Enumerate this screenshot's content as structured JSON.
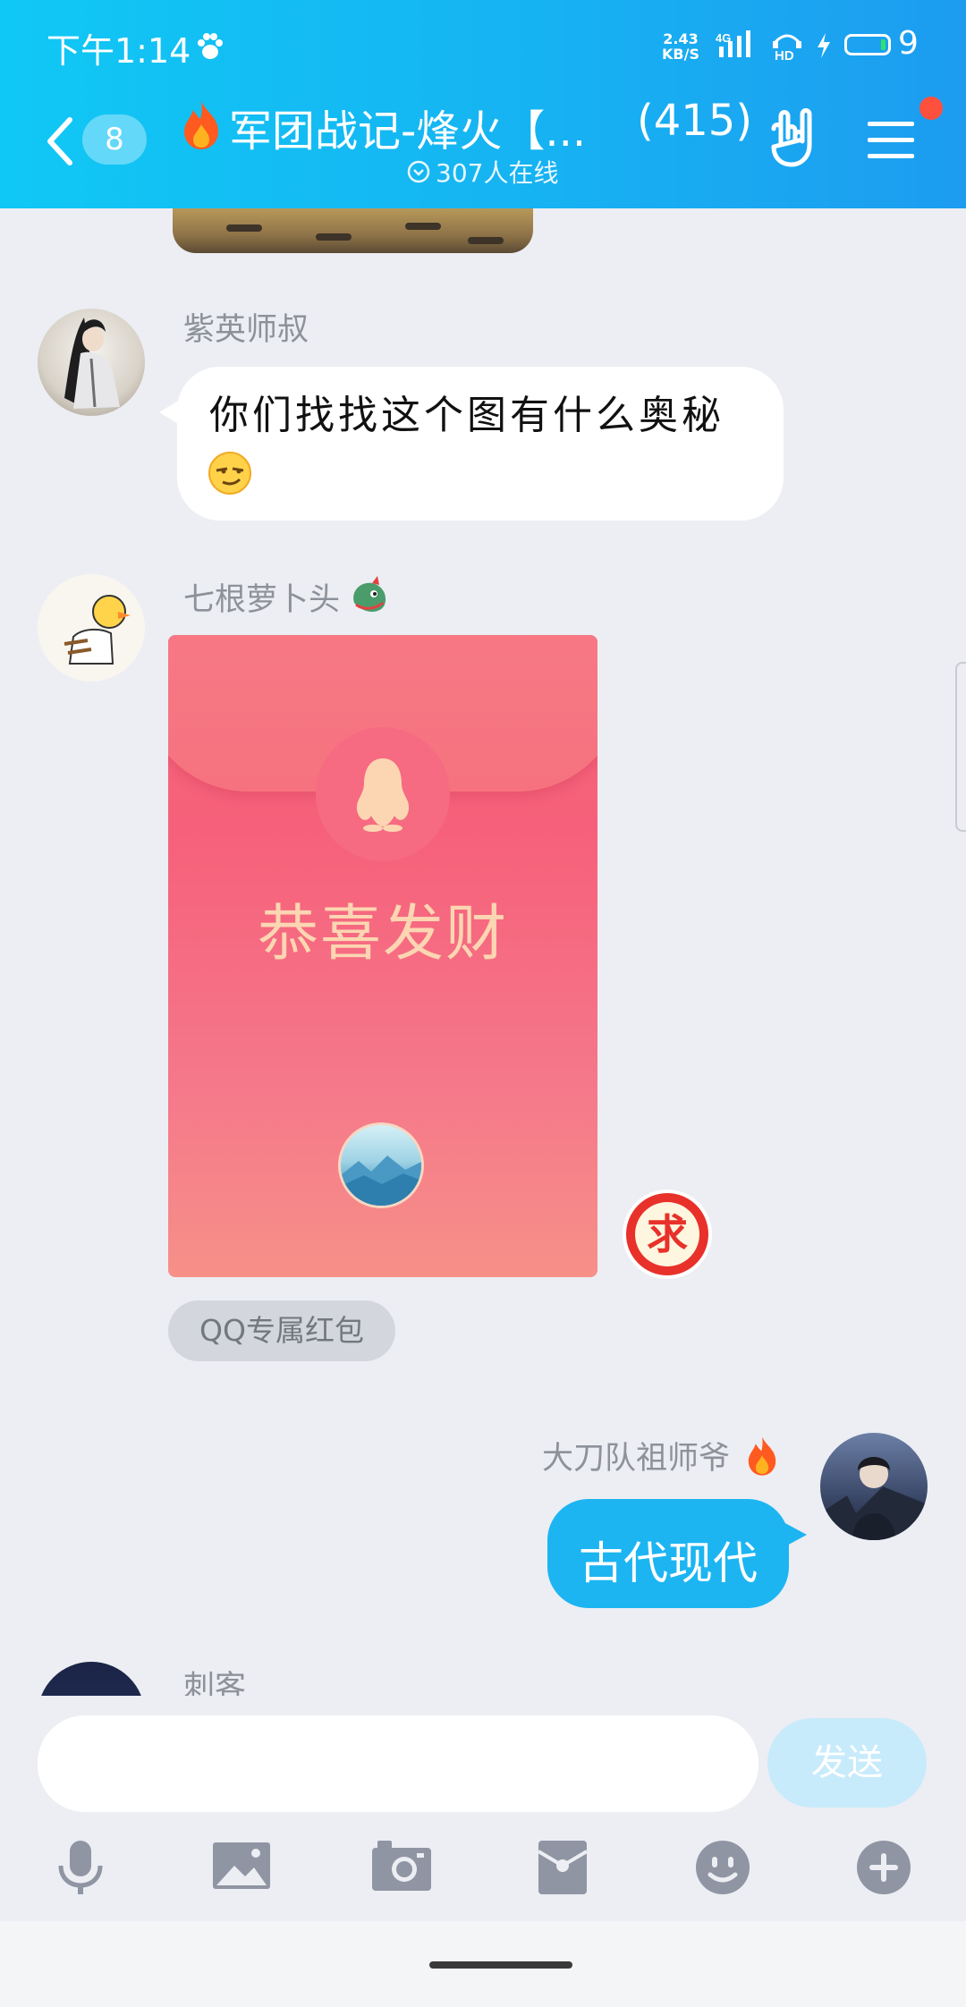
{
  "status_bar": {
    "time": "下午1:14",
    "net_speed_value": "2.43",
    "net_speed_unit": "KB/S",
    "network": "4G",
    "hd": "HD",
    "battery_level": "9"
  },
  "header": {
    "unread_count": "8",
    "group_title": "军团战记-烽火【...",
    "member_count": "(415)",
    "online_text": "307人在线"
  },
  "messages": [
    {
      "sender": "紫英师叔",
      "text": "你们找找这个图有什么奥秘",
      "emoji": "smirk-emoji"
    },
    {
      "sender": "七根萝卜头",
      "red_packet": {
        "greeting": "恭喜发财",
        "tag": "QQ专属红包",
        "badge_char": "求"
      }
    },
    {
      "sender": "大刀队祖师爷",
      "text": "古代现代",
      "outgoing": true
    },
    {
      "sender": "刺客"
    }
  ],
  "input": {
    "placeholder": "",
    "send_label": "发送"
  },
  "toolbar": [
    "microphone-icon",
    "image-icon",
    "camera-icon",
    "red-packet-icon",
    "emoji-icon",
    "plus-icon"
  ],
  "colors": {
    "header_start": "#10c8f5",
    "header_end": "#1d9cf0",
    "accent": "#1cb5f2",
    "red_packet": "#f6607a"
  }
}
